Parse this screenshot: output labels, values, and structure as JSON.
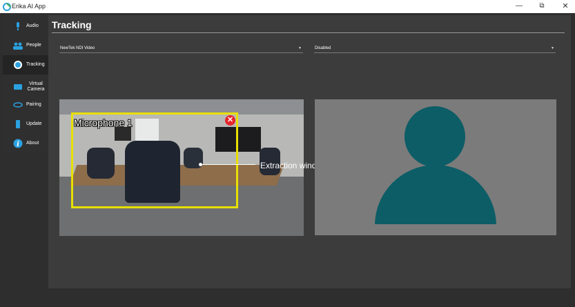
{
  "window": {
    "app_title": "Erika AI App",
    "controls": {
      "minimize": "—",
      "maximize": "⧉",
      "close": "✕"
    }
  },
  "sidebar": {
    "items": [
      {
        "label": "Audio",
        "icon": "microphone-icon",
        "active": false
      },
      {
        "label": "People",
        "icon": "people-icon",
        "active": false
      },
      {
        "label": "Tracking",
        "icon": "tracking-icon",
        "active": true
      },
      {
        "label": "Virtual Camera",
        "icon": "camera-icon",
        "active": false
      },
      {
        "label": "Pairing",
        "icon": "link-icon",
        "active": false
      },
      {
        "label": "Update",
        "icon": "update-icon",
        "active": false
      },
      {
        "label": "About",
        "icon": "info-icon",
        "active": false
      }
    ]
  },
  "main": {
    "title": "Tracking",
    "source_select": {
      "value": "NewTek NDI Video"
    },
    "mode_select": {
      "value": "Disabled"
    },
    "extraction": {
      "label": "Microphone 1",
      "close_symbol": "✕",
      "annotation": "Extraction window, click and drag to move"
    }
  },
  "colors": {
    "accent": "#e8e000",
    "close": "#e5252a",
    "avatar": "#0c5d66",
    "icon_blue": "#2aa1e0"
  }
}
